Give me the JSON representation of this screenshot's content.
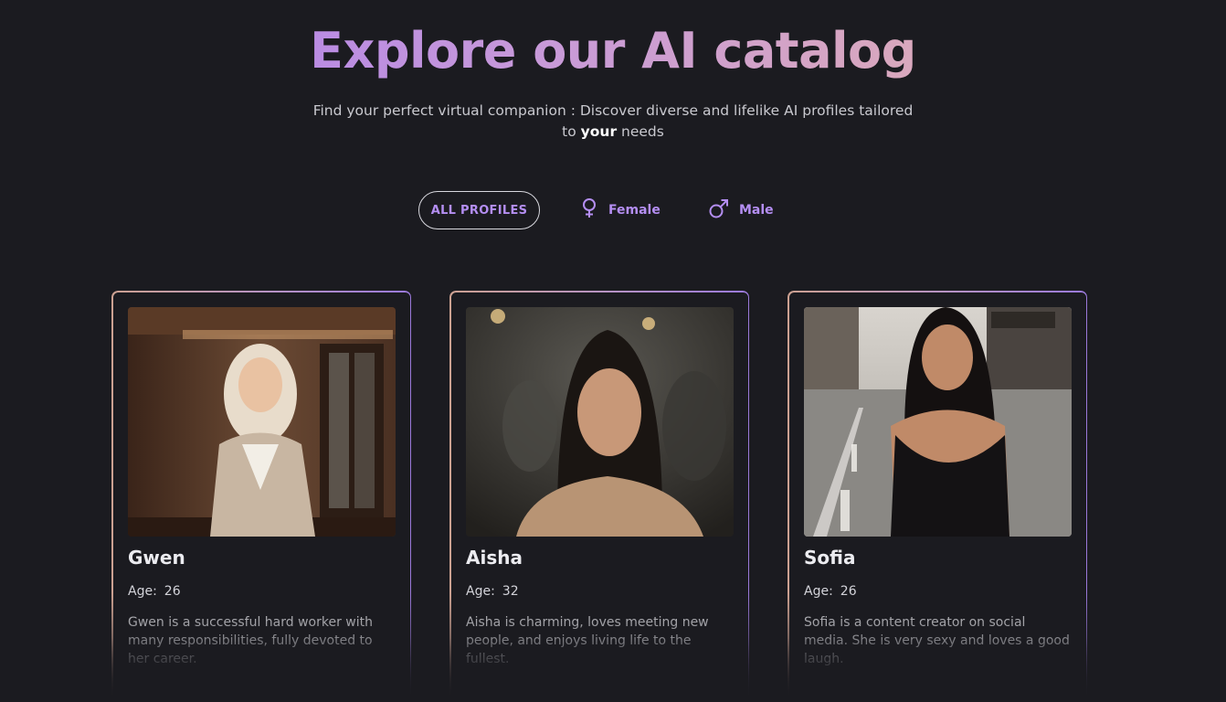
{
  "header": {
    "title": "Explore our AI catalog",
    "subtitle_before": "Find your perfect virtual companion : Discover diverse and lifelike AI profiles tailored to ",
    "subtitle_bold": "your",
    "subtitle_after": " needs"
  },
  "filters": {
    "all_label": "ALL PROFILES",
    "female_label": "Female",
    "male_label": "Male",
    "female_icon": "venus-icon",
    "male_icon": "mars-icon",
    "accent": "#b48ef2"
  },
  "profiles": [
    {
      "name": "Gwen",
      "age_label": "Age:",
      "age": "26",
      "description": "Gwen is a successful hard worker with many responsibilities, fully devoted to her career."
    },
    {
      "name": "Aisha",
      "age_label": "Age:",
      "age": "32",
      "description": "Aisha is charming, loves meeting new people, and enjoys living life to the fullest."
    },
    {
      "name": "Sofia",
      "age_label": "Age:",
      "age": "26",
      "description": "Sofia is a content creator on social media. She is very sexy and loves a good laugh."
    }
  ],
  "colors": {
    "background": "#1b1b20",
    "title_gradient_start": "#a87af0",
    "title_gradient_end": "#e8b4a6",
    "card_border_start": "#e0b09e",
    "card_border_end": "#a884ee"
  }
}
